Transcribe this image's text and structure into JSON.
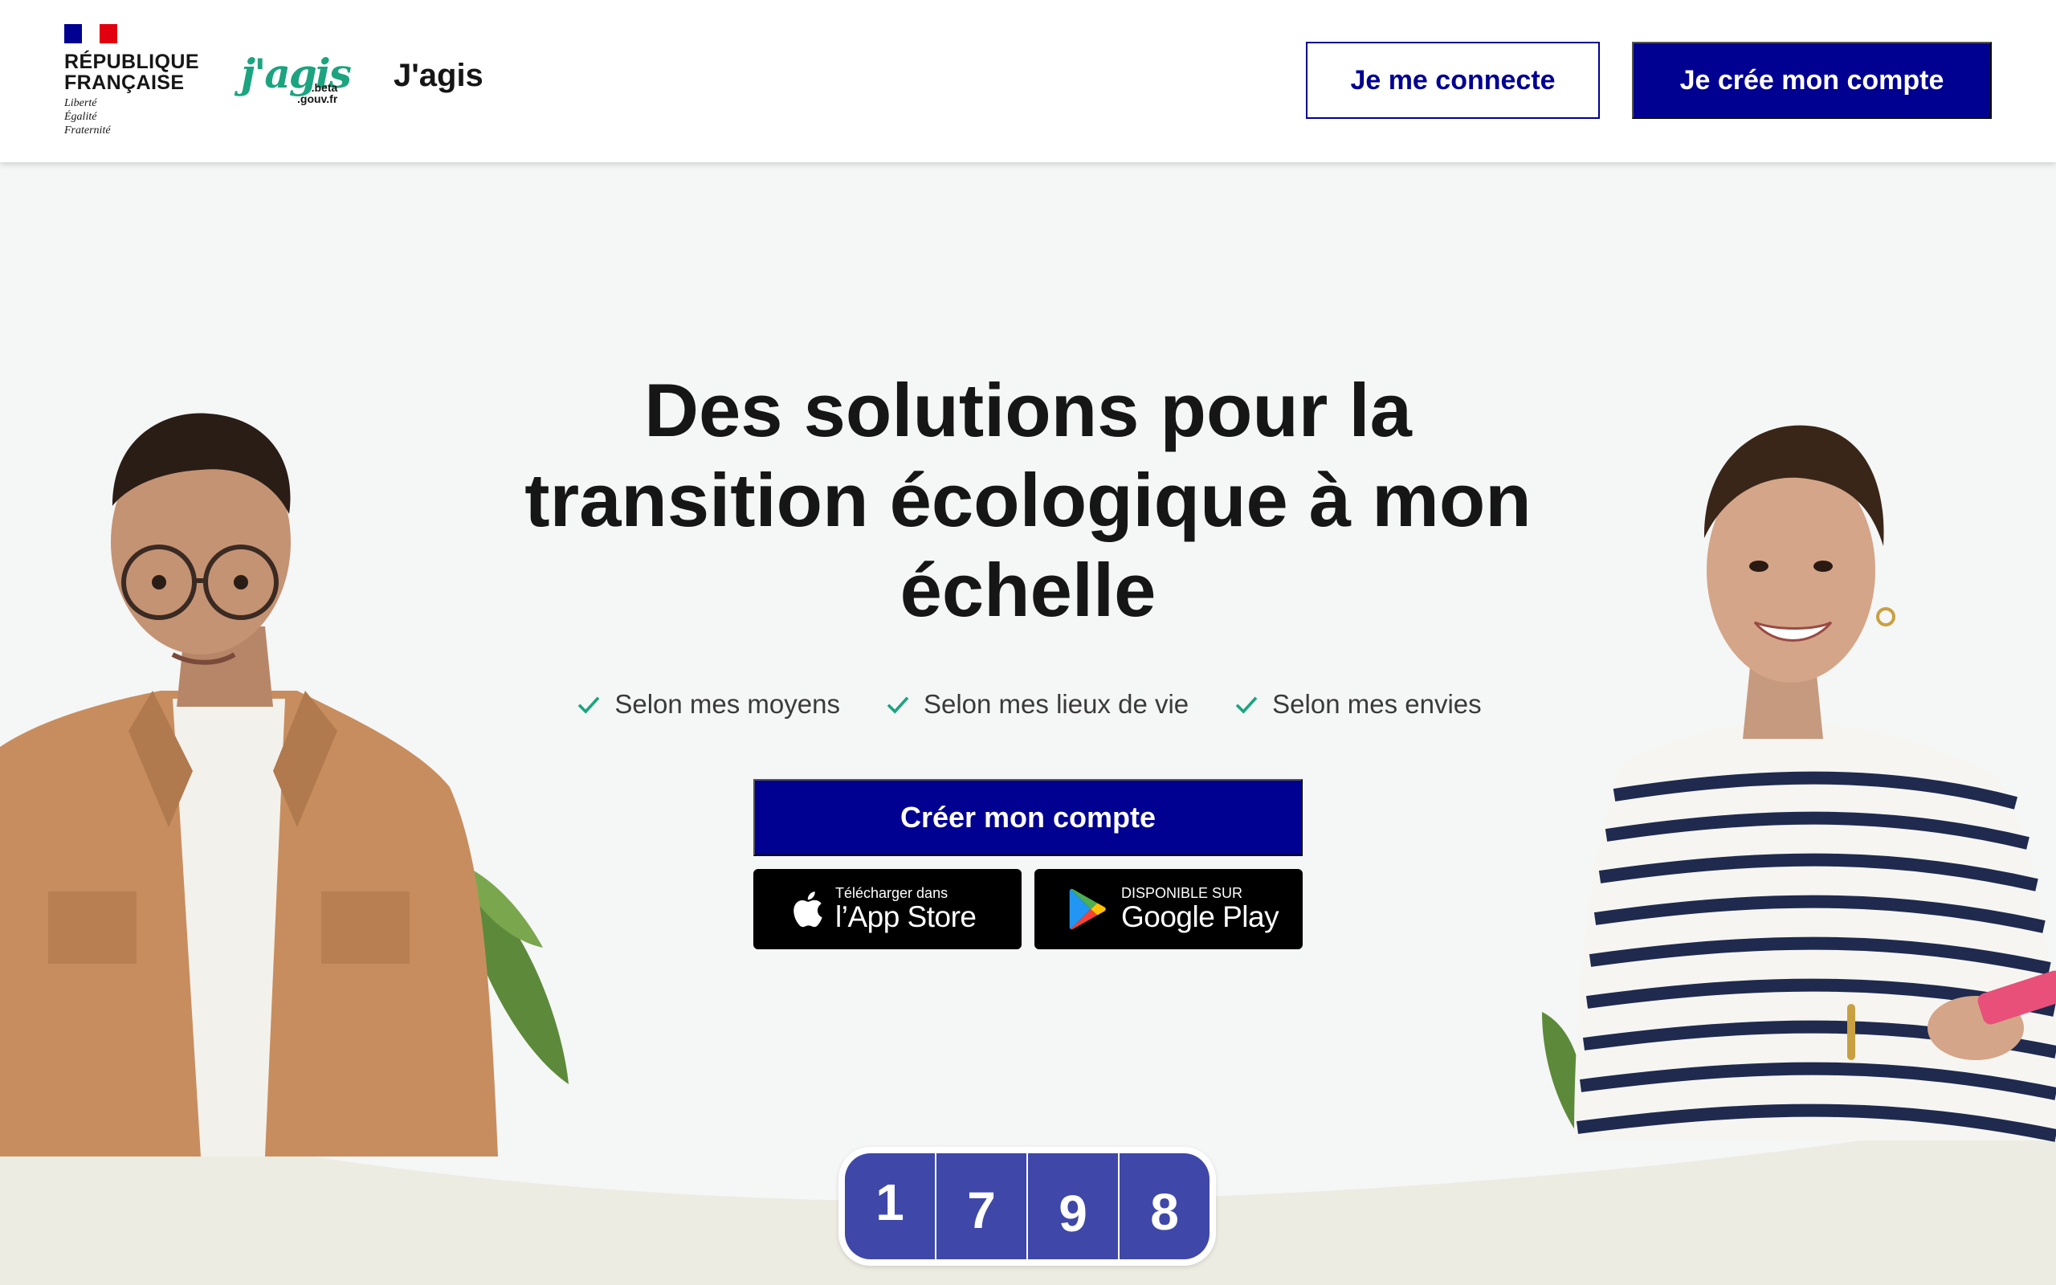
{
  "header": {
    "republic_name": "RÉPUBLIQUE\nFRANÇAISE",
    "motto": "Liberté\nÉgalité\nFraternité",
    "logo_script": "j'agis",
    "logo_domain": ".beta\n.gouv.fr",
    "site_title": "J'agis",
    "login_label": "Je me connecte",
    "signup_label": "Je crée mon compte"
  },
  "hero": {
    "title": "Des solutions pour la\ntransition écologique à mon\néchelle",
    "features": [
      "Selon mes moyens",
      "Selon mes lieux de vie",
      "Selon mes envies"
    ],
    "cta_label": "Créer mon compte",
    "app_store": {
      "small": "Télécharger dans",
      "big": "l’App Store"
    },
    "google_play": {
      "small": "DISPONIBLE SUR",
      "big": "Google Play"
    }
  },
  "counter": {
    "digits": [
      "1",
      "7",
      "9",
      "8"
    ]
  },
  "colors": {
    "primary": "#000091",
    "accent_green": "#1ba47f",
    "hero_bg": "#f5f6f6",
    "ground": "#edece2",
    "counter_blue": "#3f48a8",
    "flag_blue": "#000091",
    "flag_red": "#e1000f"
  }
}
